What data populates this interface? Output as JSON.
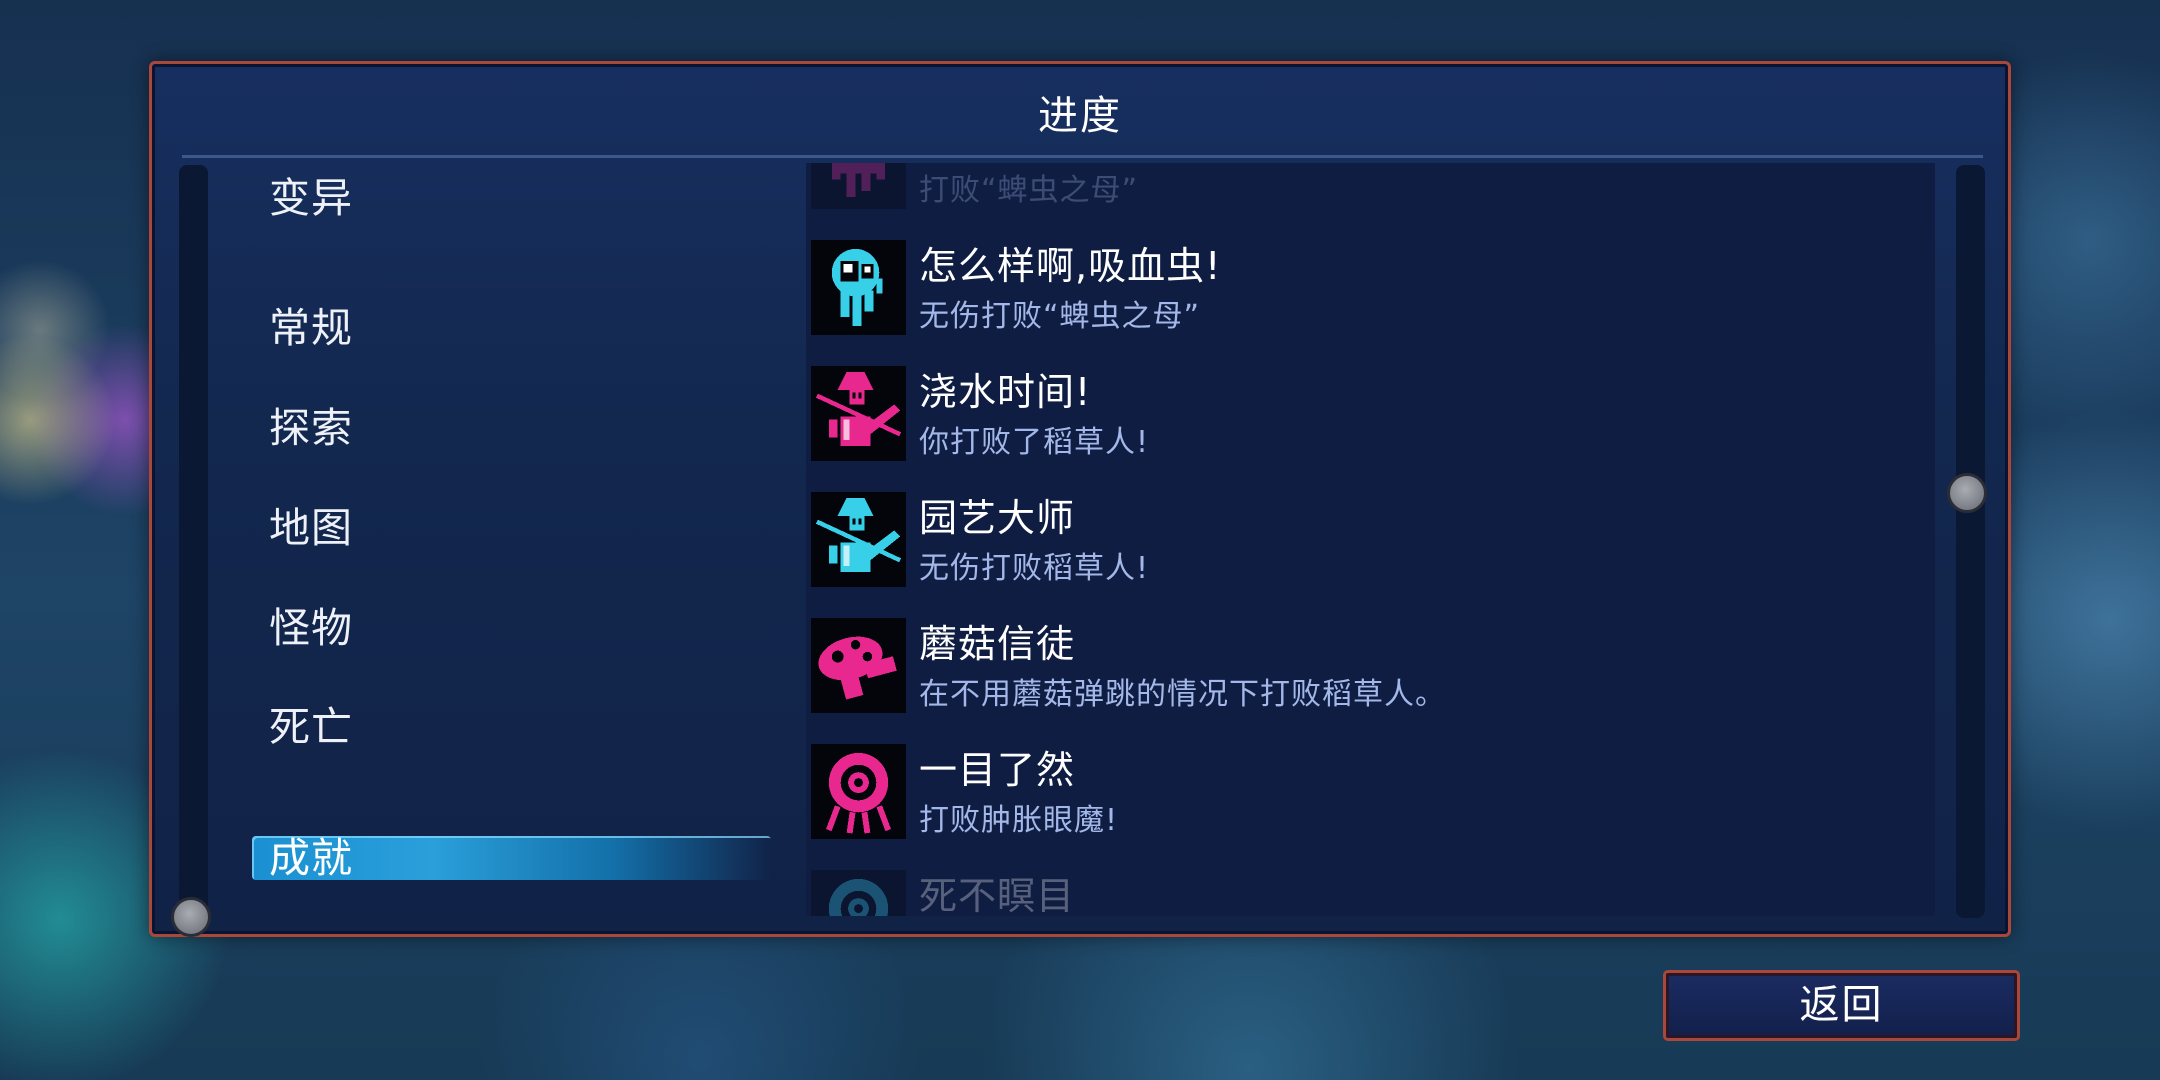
{
  "header": {
    "title": "进度"
  },
  "menu": {
    "selected": "成就",
    "items": [
      {
        "label": "变异"
      },
      {
        "label": "常规"
      },
      {
        "label": "探索"
      },
      {
        "label": "地图"
      },
      {
        "label": "怪物"
      },
      {
        "label": "死亡"
      },
      {
        "label": "成就"
      }
    ]
  },
  "achievements": [
    {
      "title": "",
      "description": "打败“蜱虫之母”",
      "icon": "tick-mother-icon",
      "color": "#e8278f"
    },
    {
      "title": "怎么样啊,吸血虫!",
      "description": "无伤打败“蜱虫之母”",
      "icon": "tick-creature-icon",
      "color": "#38d0e8"
    },
    {
      "title": "浇水时间!",
      "description": "你打败了稻草人!",
      "icon": "scarecrow-watering-can-icon",
      "color": "#e8278f"
    },
    {
      "title": "园艺大师",
      "description": "无伤打败稻草人!",
      "icon": "scarecrow-watering-can-icon",
      "color": "#38d0e8"
    },
    {
      "title": "蘑菇信徒",
      "description": "在不用蘑菇弹跳的情况下打败稻草人。",
      "icon": "mushroom-icon",
      "color": "#e8278f"
    },
    {
      "title": "一目了然",
      "description": "打败肿胀眼魔!",
      "icon": "eye-monster-icon",
      "color": "#e8278f"
    },
    {
      "title": "死不瞑目",
      "description": "",
      "icon": "eye-monster-icon",
      "color": "#38d0e8"
    }
  ],
  "footer": {
    "back_label": "返回"
  },
  "colors": {
    "frame_border": "#a9473a",
    "selected_bar": "#1a90d2",
    "accent_pink": "#e8278f",
    "accent_cyan": "#38d0e8"
  }
}
